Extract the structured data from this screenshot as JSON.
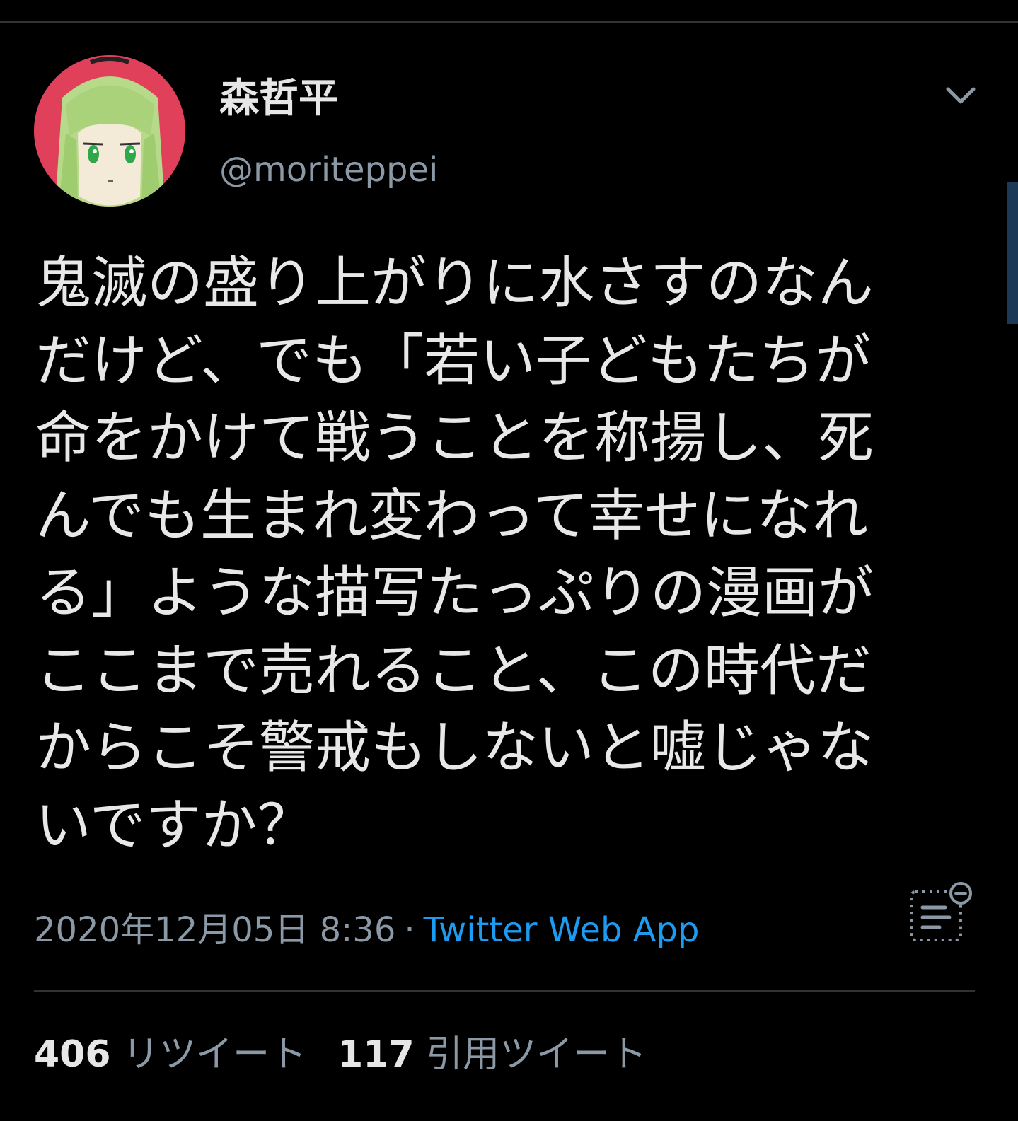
{
  "author": {
    "display_name": "森哲平",
    "handle": "@moriteppei"
  },
  "tweet": {
    "text": "鬼滅の盛り上がりに水さすのなん\nだけど、でも「若い子どもたちが\n命をかけて戦うことを称揚し、死\nんでも生まれ変わって幸せになれ\nる」ような描写たっぷりの漫画が\nここまで売れること、この時代だ\nからこそ警戒もしないと嘘じゃな\nいですか？",
    "timestamp": "2020年12月05日 8:36",
    "separator": "·",
    "source": "Twitter Web App"
  },
  "stats": {
    "retweets_count": "406",
    "retweets_label": "リツイート",
    "quotes_count": "117",
    "quotes_label": "引用ツイート"
  },
  "icons": {
    "more": "chevron-down-icon",
    "analytics": "analytics-icon"
  },
  "colors": {
    "background": "#000000",
    "primary_text": "#e8e8e8",
    "secondary_text": "#8b98a5",
    "link": "#1d9bf0",
    "divider": "#2f3336"
  }
}
